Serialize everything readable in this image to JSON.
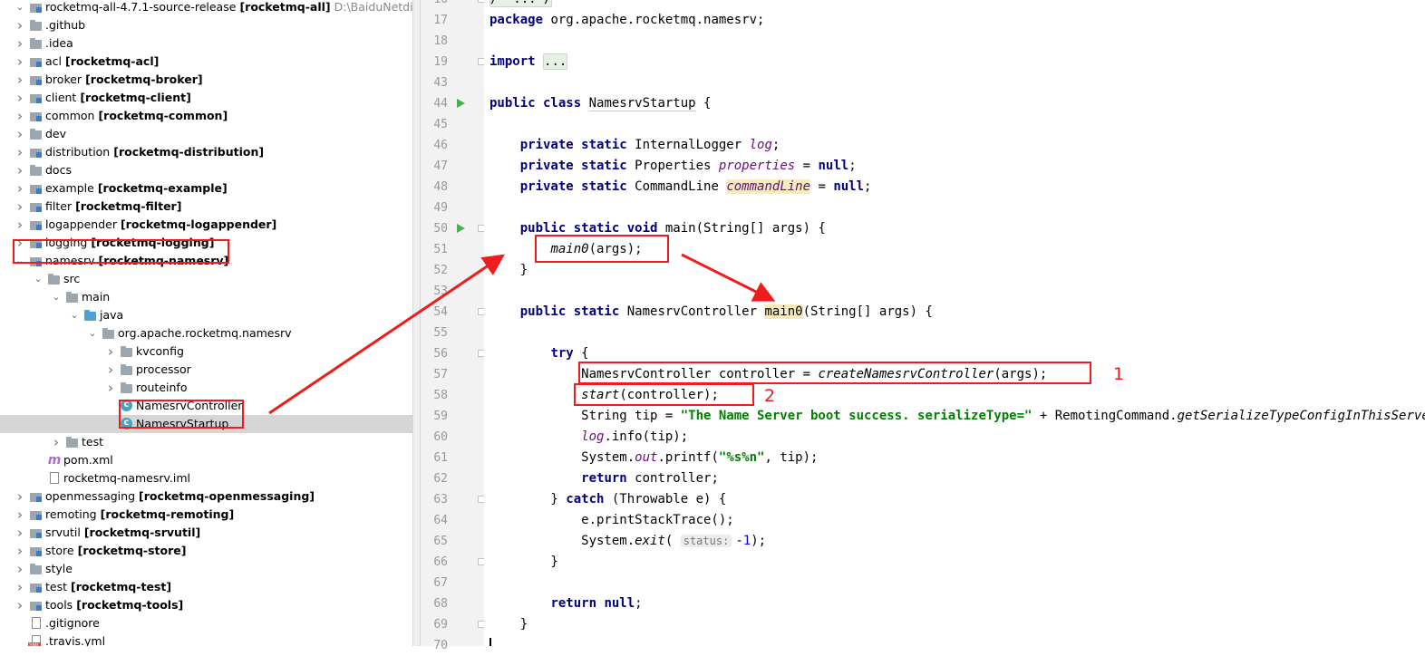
{
  "tree": [
    {
      "indent": 0,
      "arrow": "v",
      "icon": "module",
      "name": "rocketmq-all-4.7.1-source-release",
      "module": "[rocketmq-all]",
      "path": "D:\\BaiduNetdiskDownload\\..."
    },
    {
      "indent": 0,
      "arrow": ">",
      "icon": "folder",
      "name": ".github"
    },
    {
      "indent": 0,
      "arrow": ">",
      "icon": "folder",
      "name": ".idea"
    },
    {
      "indent": 0,
      "arrow": ">",
      "icon": "module",
      "name": "acl",
      "module": "[rocketmq-acl]"
    },
    {
      "indent": 0,
      "arrow": ">",
      "icon": "module",
      "name": "broker",
      "module": "[rocketmq-broker]"
    },
    {
      "indent": 0,
      "arrow": ">",
      "icon": "module",
      "name": "client",
      "module": "[rocketmq-client]"
    },
    {
      "indent": 0,
      "arrow": ">",
      "icon": "module",
      "name": "common",
      "module": "[rocketmq-common]"
    },
    {
      "indent": 0,
      "arrow": ">",
      "icon": "folder",
      "name": "dev"
    },
    {
      "indent": 0,
      "arrow": ">",
      "icon": "module",
      "name": "distribution",
      "module": "[rocketmq-distribution]"
    },
    {
      "indent": 0,
      "arrow": ">",
      "icon": "folder",
      "name": "docs"
    },
    {
      "indent": 0,
      "arrow": ">",
      "icon": "module",
      "name": "example",
      "module": "[rocketmq-example]"
    },
    {
      "indent": 0,
      "arrow": ">",
      "icon": "module",
      "name": "filter",
      "module": "[rocketmq-filter]"
    },
    {
      "indent": 0,
      "arrow": ">",
      "icon": "module",
      "name": "logappender",
      "module": "[rocketmq-logappender]"
    },
    {
      "indent": 0,
      "arrow": ">",
      "icon": "module",
      "name": "logging",
      "module": "[rocketmq-logging]"
    },
    {
      "indent": 0,
      "arrow": "v",
      "icon": "module",
      "name": "namesrv",
      "module": "[rocketmq-namesrv]"
    },
    {
      "indent": 1,
      "arrow": "v",
      "icon": "folder",
      "name": "src"
    },
    {
      "indent": 2,
      "arrow": "v",
      "icon": "folder",
      "name": "main"
    },
    {
      "indent": 3,
      "arrow": "v",
      "icon": "src",
      "name": "java"
    },
    {
      "indent": 4,
      "arrow": "v",
      "icon": "pkg",
      "name": "org.apache.rocketmq.namesrv"
    },
    {
      "indent": 5,
      "arrow": ">",
      "icon": "pkg",
      "name": "kvconfig"
    },
    {
      "indent": 5,
      "arrow": ">",
      "icon": "pkg",
      "name": "processor"
    },
    {
      "indent": 5,
      "arrow": ">",
      "icon": "pkg",
      "name": "routeinfo"
    },
    {
      "indent": 5,
      "arrow": "",
      "icon": "class",
      "name": "NamesrvController"
    },
    {
      "indent": 5,
      "arrow": "",
      "icon": "class",
      "name": "NamesrvStartup",
      "selected": true
    },
    {
      "indent": 2,
      "arrow": ">",
      "icon": "folder",
      "name": "test"
    },
    {
      "indent": 1,
      "arrow": "",
      "icon": "maven",
      "name": "pom.xml"
    },
    {
      "indent": 1,
      "arrow": "",
      "icon": "file",
      "name": "rocketmq-namesrv.iml"
    },
    {
      "indent": 0,
      "arrow": ">",
      "icon": "module",
      "name": "openmessaging",
      "module": "[rocketmq-openmessaging]"
    },
    {
      "indent": 0,
      "arrow": ">",
      "icon": "module",
      "name": "remoting",
      "module": "[rocketmq-remoting]"
    },
    {
      "indent": 0,
      "arrow": ">",
      "icon": "module",
      "name": "srvutil",
      "module": "[rocketmq-srvutil]"
    },
    {
      "indent": 0,
      "arrow": ">",
      "icon": "module",
      "name": "store",
      "module": "[rocketmq-store]"
    },
    {
      "indent": 0,
      "arrow": ">",
      "icon": "folder",
      "name": "style"
    },
    {
      "indent": 0,
      "arrow": ">",
      "icon": "module",
      "name": "test",
      "module": "[rocketmq-test]"
    },
    {
      "indent": 0,
      "arrow": ">",
      "icon": "module",
      "name": "tools",
      "module": "[rocketmq-tools]"
    },
    {
      "indent": 0,
      "arrow": "",
      "icon": "file",
      "name": ".gitignore"
    },
    {
      "indent": 0,
      "arrow": "",
      "icon": "yml",
      "name": ".travis.yml"
    }
  ],
  "code": [
    {
      "ln": "16",
      "fold": true,
      "parts": [
        {
          "t": "/**...*/",
          "c": "fold-txt"
        }
      ]
    },
    {
      "ln": "17",
      "parts": [
        {
          "t": "package",
          "c": "kw"
        },
        {
          "t": " org.apache.rocketmq.namesrv;"
        }
      ]
    },
    {
      "ln": "18",
      "parts": []
    },
    {
      "ln": "19",
      "fold": true,
      "parts": [
        {
          "t": "import",
          "c": "kw"
        },
        {
          "t": " "
        },
        {
          "t": "...",
          "c": "fold-txt"
        }
      ]
    },
    {
      "ln": "43",
      "parts": []
    },
    {
      "ln": "44",
      "run": true,
      "parts": [
        {
          "t": "public class",
          "c": "kw"
        },
        {
          "t": " "
        },
        {
          "t": "NamesrvStartup",
          "c": "cls-ul"
        },
        {
          "t": " {"
        }
      ]
    },
    {
      "ln": "45",
      "parts": []
    },
    {
      "ln": "46",
      "parts": [
        {
          "t": "    "
        },
        {
          "t": "private static",
          "c": "kw"
        },
        {
          "t": " InternalLogger "
        },
        {
          "t": "log",
          "c": "fld"
        },
        {
          "t": ";"
        }
      ]
    },
    {
      "ln": "47",
      "parts": [
        {
          "t": "    "
        },
        {
          "t": "private static",
          "c": "kw"
        },
        {
          "t": " Properties "
        },
        {
          "t": "properties",
          "c": "fld"
        },
        {
          "t": " = "
        },
        {
          "t": "null",
          "c": "kw"
        },
        {
          "t": ";"
        }
      ]
    },
    {
      "ln": "48",
      "parts": [
        {
          "t": "    "
        },
        {
          "t": "private static",
          "c": "kw"
        },
        {
          "t": " CommandLine "
        },
        {
          "t": "commandLine",
          "c": "fld hl"
        },
        {
          "t": " = "
        },
        {
          "t": "null",
          "c": "kw"
        },
        {
          "t": ";"
        }
      ]
    },
    {
      "ln": "49",
      "parts": []
    },
    {
      "ln": "50",
      "run": true,
      "fold": true,
      "parts": [
        {
          "t": "    "
        },
        {
          "t": "public static void",
          "c": "kw"
        },
        {
          "t": " main(String[] args) {"
        }
      ]
    },
    {
      "ln": "51",
      "parts": [
        {
          "t": "        "
        },
        {
          "t": "main0",
          "c": "ital"
        },
        {
          "t": "(args);"
        }
      ]
    },
    {
      "ln": "52",
      "parts": [
        {
          "t": "    }"
        }
      ]
    },
    {
      "ln": "53",
      "parts": []
    },
    {
      "ln": "54",
      "fold": true,
      "parts": [
        {
          "t": "    "
        },
        {
          "t": "public static",
          "c": "kw"
        },
        {
          "t": " NamesrvController "
        },
        {
          "t": "main0",
          "c": "hl"
        },
        {
          "t": "(String[] args) {"
        }
      ]
    },
    {
      "ln": "55",
      "parts": []
    },
    {
      "ln": "56",
      "fold": true,
      "parts": [
        {
          "t": "        "
        },
        {
          "t": "try",
          "c": "kw"
        },
        {
          "t": " {"
        }
      ]
    },
    {
      "ln": "57",
      "parts": [
        {
          "t": "            NamesrvController controller = "
        },
        {
          "t": "createNamesrvController",
          "c": "ital"
        },
        {
          "t": "(args);"
        }
      ]
    },
    {
      "ln": "58",
      "parts": [
        {
          "t": "            "
        },
        {
          "t": "start",
          "c": "ital"
        },
        {
          "t": "(controller);"
        }
      ]
    },
    {
      "ln": "59",
      "parts": [
        {
          "t": "            String tip = "
        },
        {
          "t": "\"The Name Server boot success. serializeType=\"",
          "c": "str"
        },
        {
          "t": " + RemotingCommand."
        },
        {
          "t": "getSerializeTypeConfigInThisServer",
          "c": "ital"
        },
        {
          "t": "();"
        }
      ]
    },
    {
      "ln": "60",
      "parts": [
        {
          "t": "            "
        },
        {
          "t": "log",
          "c": "fld"
        },
        {
          "t": ".info(tip);"
        }
      ]
    },
    {
      "ln": "61",
      "parts": [
        {
          "t": "            System."
        },
        {
          "t": "out",
          "c": "fld"
        },
        {
          "t": ".printf("
        },
        {
          "t": "\"%s%n\"",
          "c": "str"
        },
        {
          "t": ", tip);"
        }
      ]
    },
    {
      "ln": "62",
      "parts": [
        {
          "t": "            "
        },
        {
          "t": "return",
          "c": "kw"
        },
        {
          "t": " controller;"
        }
      ]
    },
    {
      "ln": "63",
      "fold": true,
      "parts": [
        {
          "t": "        } "
        },
        {
          "t": "catch",
          "c": "kw"
        },
        {
          "t": " (Throwable e) {"
        }
      ]
    },
    {
      "ln": "64",
      "parts": [
        {
          "t": "            e.printStackTrace();"
        }
      ]
    },
    {
      "ln": "65",
      "parts": [
        {
          "t": "            System."
        },
        {
          "t": "exit",
          "c": "ital"
        },
        {
          "t": "( "
        },
        {
          "t": "status:",
          "c": "hint"
        },
        {
          "t": "-"
        },
        {
          "t": "1",
          "c": "num"
        },
        {
          "t": ");"
        }
      ]
    },
    {
      "ln": "66",
      "fold": true,
      "parts": [
        {
          "t": "        }"
        }
      ]
    },
    {
      "ln": "67",
      "parts": []
    },
    {
      "ln": "68",
      "parts": [
        {
          "t": "        "
        },
        {
          "t": "return null",
          "c": "kw"
        },
        {
          "t": ";"
        }
      ]
    },
    {
      "ln": "69",
      "fold": true,
      "parts": [
        {
          "t": "    }"
        }
      ]
    },
    {
      "ln": "70",
      "parts": []
    }
  ],
  "annotations": {
    "label1": "1",
    "label2": "2",
    "color": "#ee1c1c"
  }
}
